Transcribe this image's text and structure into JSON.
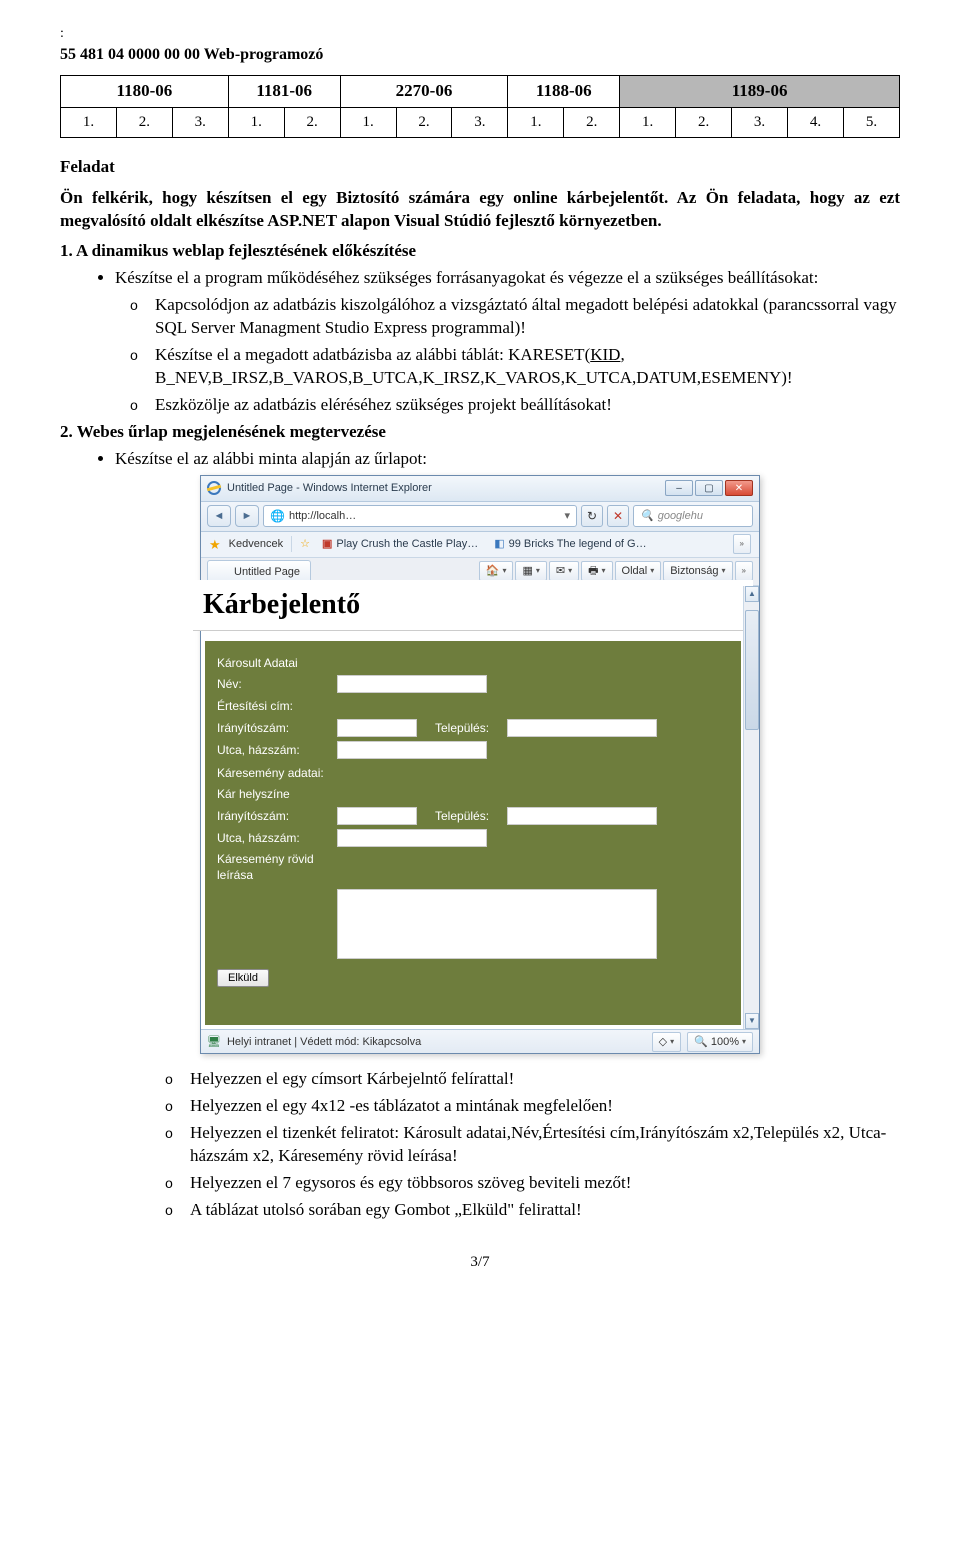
{
  "header": {
    "colon": ":",
    "code_line": "55 481 04 0000 00 00 Web-programozó"
  },
  "table": {
    "headers": [
      "1180-06",
      "1181-06",
      "2270-06",
      "1188-06",
      "1189-06"
    ],
    "row": [
      [
        "1.",
        "2.",
        "3."
      ],
      [
        "1.",
        "2."
      ],
      [
        "1.",
        "2.",
        "3."
      ],
      [
        "1.",
        "2."
      ],
      [
        "1.",
        "2.",
        "3.",
        "4.",
        "5."
      ]
    ]
  },
  "feladat_title": "Feladat",
  "intro_p1": "Ön felkérik, hogy készítsen el egy Biztosító számára egy online kárbejelentőt. Az Ön feladata, hogy az ezt megvalósító oldalt elkészítse ASP.NET alapon Visual Stúdió fejlesztő környezetben.",
  "step1_title": "1. A dinamikus weblap fejlesztésének előkészítése",
  "step1_main": "Készítse el a program működéséhez szükséges forrásanyagokat és végezze el a szükséges beállításokat:",
  "step1_sub1": "Kapcsolódjon az adatbázis kiszolgálóhoz a vizsgáztató által megadott belépési adatokkal (parancssorral vagy SQL Server Managment Studio Express programmal)!",
  "step1_sub2a": "Készítse el a megadott adatbázisba az alábbi táblát: KARESET(",
  "step1_sub2_kid": "KID",
  "step1_sub2b": ", B_NEV,B_IRSZ,B_VAROS,B_UTCA,K_IRSZ,K_VAROS,K_UTCA,DATUM,ESEMENY)!",
  "step1_sub3": "Eszközölje az adatbázis eléréséhez szükséges projekt beállításokat!",
  "step2_title": "2. Webes űrlap megjelenésének megtervezése",
  "step2_main": "Készítse el az alábbi minta alapján az űrlapot:",
  "ie": {
    "title": "Untitled Page - Windows Internet Explorer",
    "url": "http://localh…",
    "search_ph": "googlehu",
    "fav_label": "Kedvencek",
    "fav_item1": "Play Crush the Castle Play…",
    "fav_item2": "99 Bricks The legend of G…",
    "tab_label": "Untitled Page",
    "cmd_oldal": "Oldal",
    "cmd_biztonsag": "Biztonság",
    "status_text": "Helyi intranet | Védett mód: Kikapcsolva",
    "zoom": "100%"
  },
  "form": {
    "title": "Kárbejelentő",
    "section1": "Károsult Adatai",
    "nev": "Név:",
    "ertcim": "Értesítési cím:",
    "irsz": "Irányítószám:",
    "telepules": "Település:",
    "utca": "Utca, házszám:",
    "section2": "Káresemény adatai:",
    "helyszin": "Kár helyszíne",
    "leiras": "Káresemény rövid leírása",
    "btn": "Elküld"
  },
  "post_list": {
    "i1": "Helyezzen el egy címsort Kárbejelntő  felírattal!",
    "i2": "Helyezzen el egy 4x12 -es táblázatot a mintának megfelelően!",
    "i3": "Helyezzen el tizenkét feliratot: Károsult adatai,Név,Értesítési cím,Irányítószám x2,Település x2, Utca-házszám x2, Káresemény rövid leírása!",
    "i4": "Helyezzen el 7 egysoros és egy többsoros szöveg beviteli mezőt!",
    "i5": "A táblázat utolsó sorában egy  Gombot  „Elküld\"  felirattal!"
  },
  "page_num": "3/7"
}
